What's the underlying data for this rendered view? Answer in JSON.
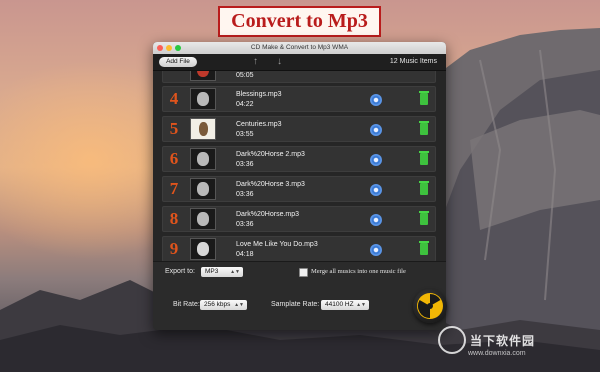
{
  "banner": {
    "title": "Convert to Mp3"
  },
  "window": {
    "title": "CD Make & Convert to Mp3 WMA",
    "lights": [
      "#fc5f57",
      "#fdbc2e",
      "#28c840"
    ]
  },
  "toolbar": {
    "add_file_label": "Add File",
    "count": "12",
    "count_label": "Music Items"
  },
  "list": {
    "partial_row": {
      "duration": "05:05"
    },
    "rows": [
      {
        "num": "4",
        "name": "Blessings.mp3",
        "duration": "04:22"
      },
      {
        "num": "5",
        "name": "Centuries.mp3",
        "duration": "03:55"
      },
      {
        "num": "6",
        "name": "Dark%20Horse 2.mp3",
        "duration": "03:36"
      },
      {
        "num": "7",
        "name": "Dark%20Horse 3.mp3",
        "duration": "03:36"
      },
      {
        "num": "8",
        "name": "Dark%20Horse.mp3",
        "duration": "03:36"
      },
      {
        "num": "9",
        "name": "Love Me Like You Do.mp3",
        "duration": "04:18"
      }
    ]
  },
  "options": {
    "export_label": "Export to:",
    "export_value": "MP3",
    "merge_label": "Merge all musics into one music file",
    "bitrate_label": "Bit Rate:",
    "bitrate_value": "256 kbps",
    "samplerate_label": "Samplate Rate:",
    "samplerate_value": "44100 HZ"
  },
  "watermark": {
    "text": "当下软件园",
    "sub": "www.downxia.com"
  },
  "colors": {
    "accent_number": "#e0541c",
    "gear": "#3b7bd6",
    "trash": "#3ec23e",
    "banner_border": "#b91c1c"
  }
}
